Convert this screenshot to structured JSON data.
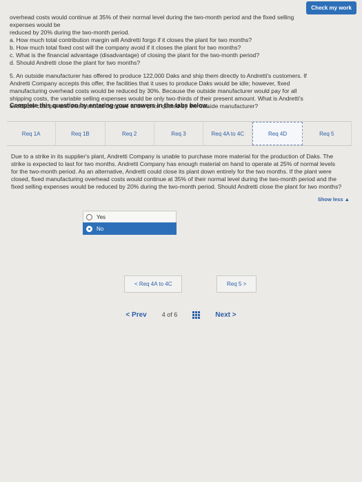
{
  "header": {
    "check_label": "Check my work"
  },
  "intro_lines": [
    "overhead costs would continue at 35% of their normal level during the two-month period and the fixed selling expenses would be",
    "reduced by 20% during the two-month period.",
    "a. How much total contribution margin will Andretti forgo if it closes the plant for two months?",
    "b. How much total fixed cost will the company avoid if it closes the plant for two months?",
    "c. What is the financial advantage (disadvantage) of closing the plant for the two-month period?",
    "d. Should Andretti close the plant for two months?"
  ],
  "q5_text": "5. An outside manufacturer has offered to produce 122,000 Daks and ship them directly to Andretti's customers. If Andretti Company accepts this offer, the facilities that it uses to produce Daks would be idle; however, fixed manufacturing overhead costs would be reduced by 30%. Because the outside manufacturer would pay for all shipping costs, the variable selling expenses would be only two-thirds of their present amount. What is Andretti's avoidable cost per unit that it should compare to the price quoted by the outside manufacturer?",
  "instructions": "Complete this question by entering your answers in the tabs below.",
  "tabs": [
    {
      "label": "Req 1A"
    },
    {
      "label": "Req 1B"
    },
    {
      "label": "Req 2"
    },
    {
      "label": "Req 3"
    },
    {
      "label": "Req 4A to 4C"
    },
    {
      "label": "Req 4D"
    },
    {
      "label": "Req 5"
    }
  ],
  "question_text": "Due to a strike in its supplier's plant, Andretti Company is unable to purchase more material for the production of Daks. The strike is expected to last for two months. Andretti Company has enough material on hand to operate at 25% of normal levels for the two-month period. As an alternative, Andretti could close its plant down entirely for the two months. If the plant were closed, fixed manufacturing overhead costs would continue at 35% of their normal level during the two-month period and the fixed selling expenses would be reduced by 20% during the two-month period. Should Andretti close the plant for two months?",
  "show_less": "Show less ▲",
  "options": [
    {
      "label": "Yes",
      "selected": false
    },
    {
      "label": "No",
      "selected": true
    }
  ],
  "subnav": {
    "prev": "< Req 4A to 4C",
    "next": "Req 5 >"
  },
  "footer": {
    "prev": "< Prev",
    "page_current": "4",
    "page_of": "of",
    "page_total": "6",
    "next": "Next >"
  }
}
